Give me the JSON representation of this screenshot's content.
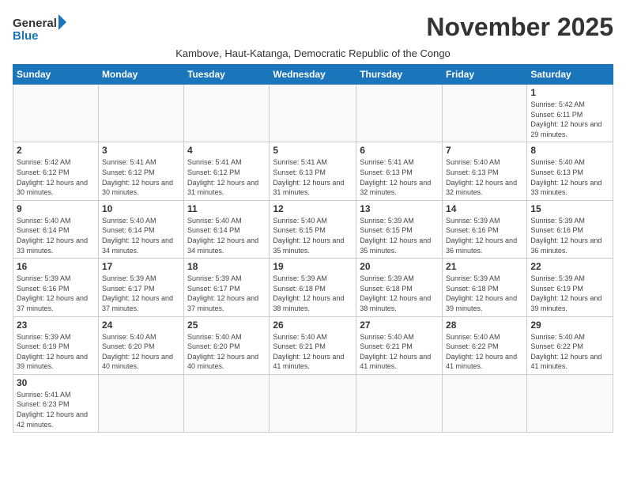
{
  "logo": {
    "text_general": "General",
    "text_blue": "Blue"
  },
  "title": "November 2025",
  "subtitle": "Kambove, Haut-Katanga, Democratic Republic of the Congo",
  "days_of_week": [
    "Sunday",
    "Monday",
    "Tuesday",
    "Wednesday",
    "Thursday",
    "Friday",
    "Saturday"
  ],
  "weeks": [
    [
      {
        "day": "",
        "info": ""
      },
      {
        "day": "",
        "info": ""
      },
      {
        "day": "",
        "info": ""
      },
      {
        "day": "",
        "info": ""
      },
      {
        "day": "",
        "info": ""
      },
      {
        "day": "",
        "info": ""
      },
      {
        "day": "1",
        "info": "Sunrise: 5:42 AM\nSunset: 6:11 PM\nDaylight: 12 hours and 29 minutes."
      }
    ],
    [
      {
        "day": "2",
        "info": "Sunrise: 5:42 AM\nSunset: 6:12 PM\nDaylight: 12 hours and 30 minutes."
      },
      {
        "day": "3",
        "info": "Sunrise: 5:41 AM\nSunset: 6:12 PM\nDaylight: 12 hours and 30 minutes."
      },
      {
        "day": "4",
        "info": "Sunrise: 5:41 AM\nSunset: 6:12 PM\nDaylight: 12 hours and 31 minutes."
      },
      {
        "day": "5",
        "info": "Sunrise: 5:41 AM\nSunset: 6:13 PM\nDaylight: 12 hours and 31 minutes."
      },
      {
        "day": "6",
        "info": "Sunrise: 5:41 AM\nSunset: 6:13 PM\nDaylight: 12 hours and 32 minutes."
      },
      {
        "day": "7",
        "info": "Sunrise: 5:40 AM\nSunset: 6:13 PM\nDaylight: 12 hours and 32 minutes."
      },
      {
        "day": "8",
        "info": "Sunrise: 5:40 AM\nSunset: 6:13 PM\nDaylight: 12 hours and 33 minutes."
      }
    ],
    [
      {
        "day": "9",
        "info": "Sunrise: 5:40 AM\nSunset: 6:14 PM\nDaylight: 12 hours and 33 minutes."
      },
      {
        "day": "10",
        "info": "Sunrise: 5:40 AM\nSunset: 6:14 PM\nDaylight: 12 hours and 34 minutes."
      },
      {
        "day": "11",
        "info": "Sunrise: 5:40 AM\nSunset: 6:14 PM\nDaylight: 12 hours and 34 minutes."
      },
      {
        "day": "12",
        "info": "Sunrise: 5:40 AM\nSunset: 6:15 PM\nDaylight: 12 hours and 35 minutes."
      },
      {
        "day": "13",
        "info": "Sunrise: 5:39 AM\nSunset: 6:15 PM\nDaylight: 12 hours and 35 minutes."
      },
      {
        "day": "14",
        "info": "Sunrise: 5:39 AM\nSunset: 6:16 PM\nDaylight: 12 hours and 36 minutes."
      },
      {
        "day": "15",
        "info": "Sunrise: 5:39 AM\nSunset: 6:16 PM\nDaylight: 12 hours and 36 minutes."
      }
    ],
    [
      {
        "day": "16",
        "info": "Sunrise: 5:39 AM\nSunset: 6:16 PM\nDaylight: 12 hours and 37 minutes."
      },
      {
        "day": "17",
        "info": "Sunrise: 5:39 AM\nSunset: 6:17 PM\nDaylight: 12 hours and 37 minutes."
      },
      {
        "day": "18",
        "info": "Sunrise: 5:39 AM\nSunset: 6:17 PM\nDaylight: 12 hours and 37 minutes."
      },
      {
        "day": "19",
        "info": "Sunrise: 5:39 AM\nSunset: 6:18 PM\nDaylight: 12 hours and 38 minutes."
      },
      {
        "day": "20",
        "info": "Sunrise: 5:39 AM\nSunset: 6:18 PM\nDaylight: 12 hours and 38 minutes."
      },
      {
        "day": "21",
        "info": "Sunrise: 5:39 AM\nSunset: 6:18 PM\nDaylight: 12 hours and 39 minutes."
      },
      {
        "day": "22",
        "info": "Sunrise: 5:39 AM\nSunset: 6:19 PM\nDaylight: 12 hours and 39 minutes."
      }
    ],
    [
      {
        "day": "23",
        "info": "Sunrise: 5:39 AM\nSunset: 6:19 PM\nDaylight: 12 hours and 39 minutes."
      },
      {
        "day": "24",
        "info": "Sunrise: 5:40 AM\nSunset: 6:20 PM\nDaylight: 12 hours and 40 minutes."
      },
      {
        "day": "25",
        "info": "Sunrise: 5:40 AM\nSunset: 6:20 PM\nDaylight: 12 hours and 40 minutes."
      },
      {
        "day": "26",
        "info": "Sunrise: 5:40 AM\nSunset: 6:21 PM\nDaylight: 12 hours and 41 minutes."
      },
      {
        "day": "27",
        "info": "Sunrise: 5:40 AM\nSunset: 6:21 PM\nDaylight: 12 hours and 41 minutes."
      },
      {
        "day": "28",
        "info": "Sunrise: 5:40 AM\nSunset: 6:22 PM\nDaylight: 12 hours and 41 minutes."
      },
      {
        "day": "29",
        "info": "Sunrise: 5:40 AM\nSunset: 6:22 PM\nDaylight: 12 hours and 41 minutes."
      }
    ],
    [
      {
        "day": "30",
        "info": "Sunrise: 5:41 AM\nSunset: 6:23 PM\nDaylight: 12 hours and 42 minutes."
      },
      {
        "day": "",
        "info": ""
      },
      {
        "day": "",
        "info": ""
      },
      {
        "day": "",
        "info": ""
      },
      {
        "day": "",
        "info": ""
      },
      {
        "day": "",
        "info": ""
      },
      {
        "day": "",
        "info": ""
      }
    ]
  ]
}
